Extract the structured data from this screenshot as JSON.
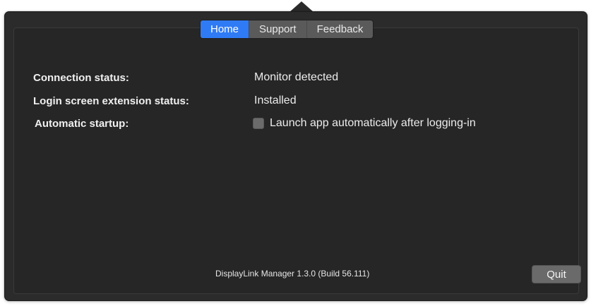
{
  "tabs": [
    {
      "label": "Home",
      "active": true
    },
    {
      "label": "Support",
      "active": false
    },
    {
      "label": "Feedback",
      "active": false
    }
  ],
  "status": {
    "connection_label": "Connection status:",
    "connection_value": "Monitor detected",
    "login_label": "Login screen extension status:",
    "login_value": "Installed",
    "startup_label": "Automatic startup:",
    "startup_checkbox_label": "Launch app automatically after logging-in",
    "startup_checked": false
  },
  "footer": {
    "version": "DisplayLink Manager 1.3.0 (Build 56.111)",
    "quit_label": "Quit"
  },
  "colors": {
    "accent": "#2f7bf5",
    "background": "#2b2b2b"
  }
}
